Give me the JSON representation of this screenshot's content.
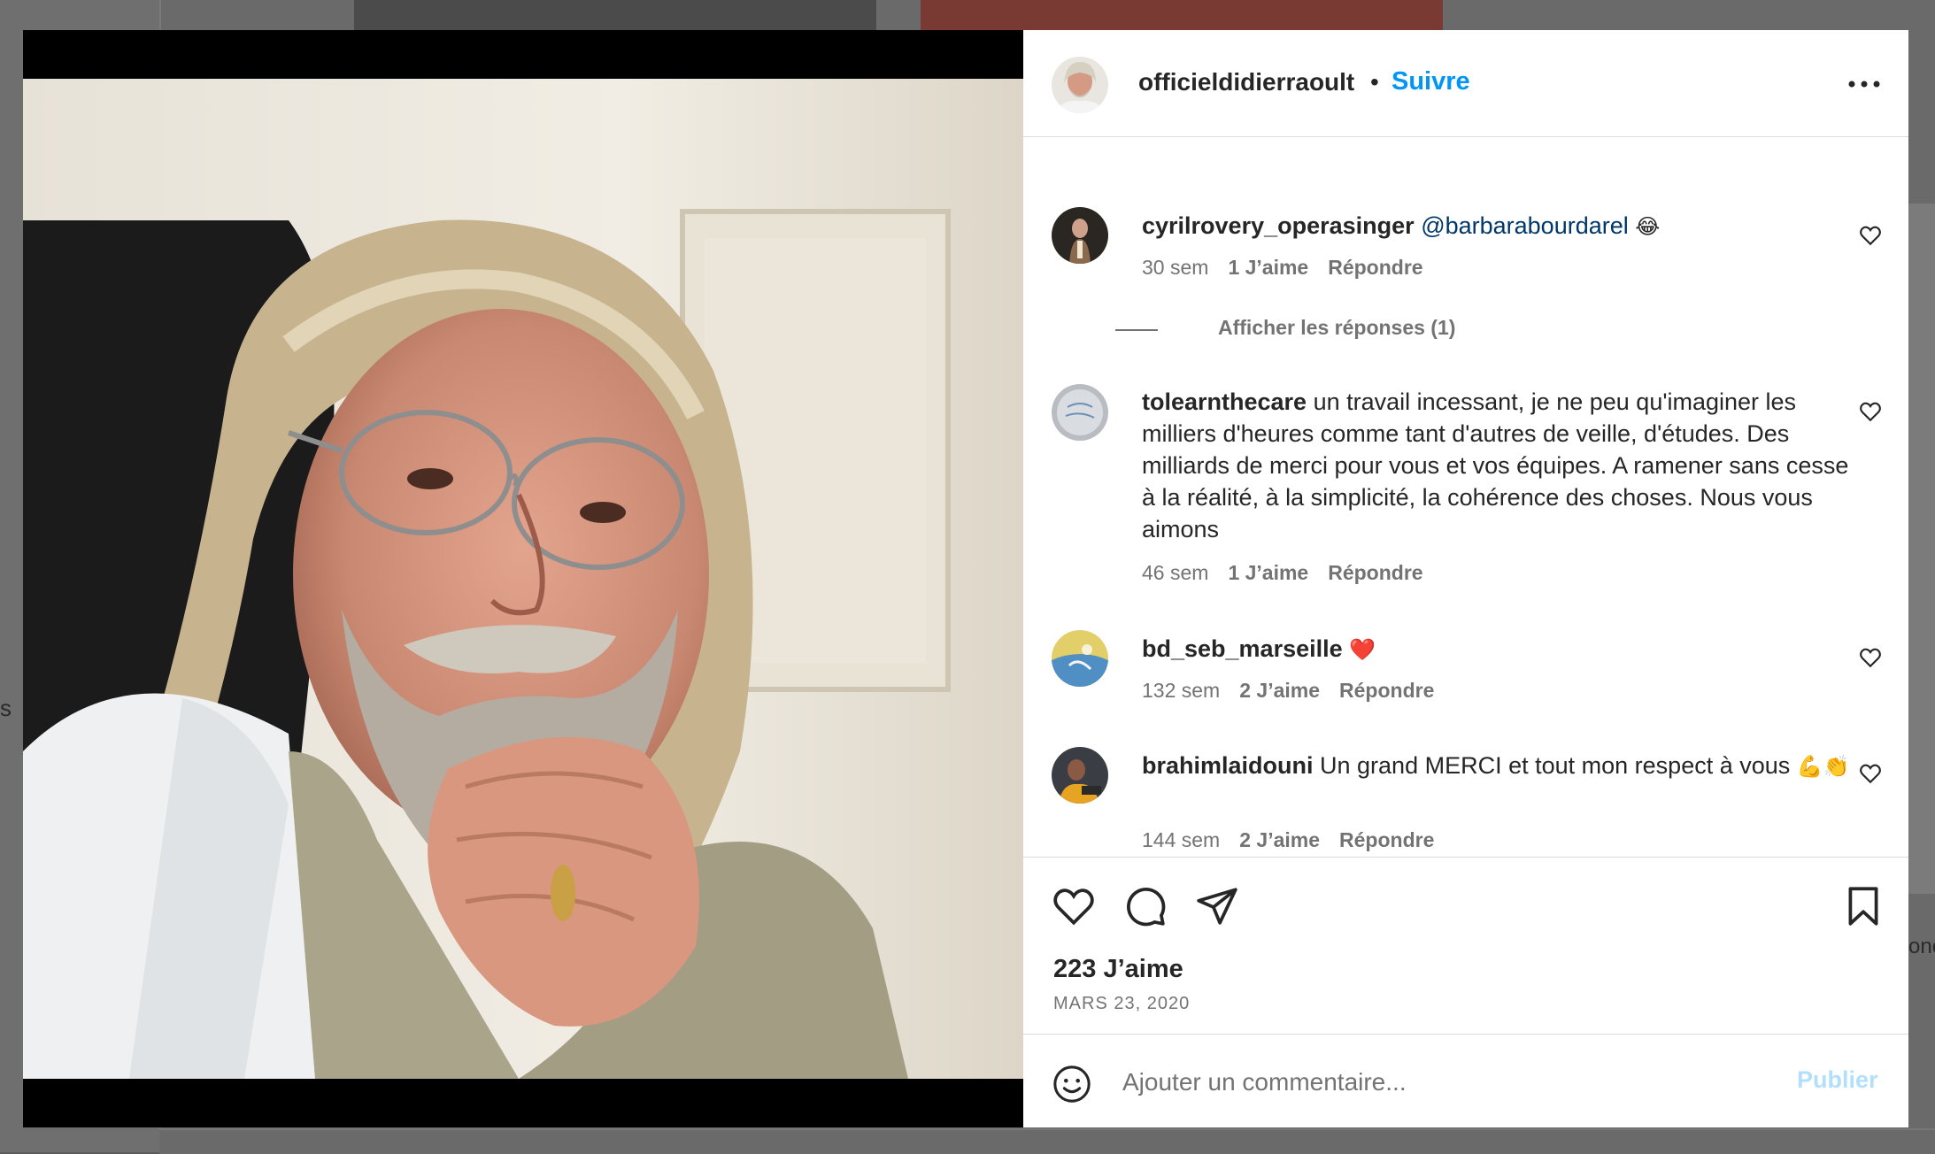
{
  "colors": {
    "accent": "#0095f6",
    "text": "#262626",
    "muted": "#737373",
    "publish_disabled": "#b2dffc",
    "heart": "#ed1c40"
  },
  "background": {
    "side_text": "onc",
    "side_glyph": "s"
  },
  "post": {
    "image_icon": "portrait-photo",
    "author": "officieldidierraoult",
    "separator": "•",
    "follow_label": "Suivre",
    "more_icon": "more-horizontal-icon"
  },
  "comments": [
    {
      "username": "cyrilrovery_operasinger",
      "text": "",
      "mention": "@barbarabourdarel",
      "emoji": "😂",
      "time": "30 sem",
      "likes": "1 J’aime",
      "reply_label": "Répondre",
      "view_replies": "Afficher les réponses (1)"
    },
    {
      "username": "tolearnthecare",
      "text": " un travail incessant, je ne peu qu'imaginer les milliers d'heures comme tant d'autres de veille, d'études. Des milliards de merci pour vous et vos équipes. A ramener sans cesse à la réalité, à la simplicité, la cohérence des choses. Nous vous aimons",
      "time": "46 sem",
      "likes": "1 J’aime",
      "reply_label": "Répondre"
    },
    {
      "username": "bd_seb_marseille",
      "text": "",
      "emoji": "❤️",
      "time": "132 sem",
      "likes": "2 J’aime",
      "reply_label": "Répondre"
    },
    {
      "username": "brahimlaidouni",
      "text": " Un grand MERCI et tout mon respect à vous",
      "emoji": "💪👏",
      "time": "144 sem",
      "likes": "2 J’aime",
      "reply_label": "Répondre"
    }
  ],
  "actions": {
    "like_icon": "heart-icon",
    "comment_icon": "comment-icon",
    "share_icon": "send-icon",
    "save_icon": "bookmark-icon",
    "likes_count": "223 J’aime",
    "date": "MARS 23, 2020"
  },
  "add_comment": {
    "emoji_icon": "smiley-icon",
    "placeholder": "Ajouter un commentaire...",
    "publish_label": "Publier"
  }
}
